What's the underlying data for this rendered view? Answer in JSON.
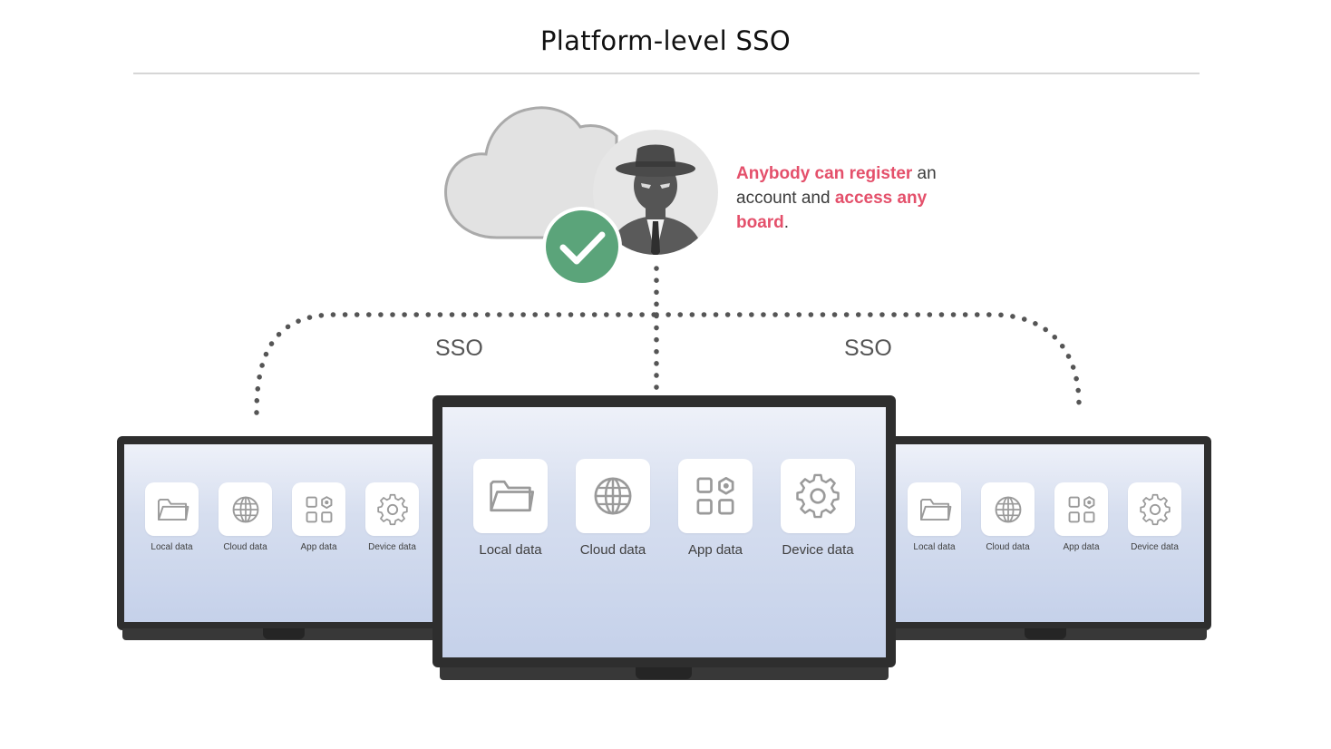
{
  "title": "Platform-level SSO",
  "caption": {
    "part1": "Anybody can register",
    "part2": " an account and ",
    "part3": "access any board",
    "part4": "."
  },
  "connector_labels": {
    "left": "SSO",
    "right": "SSO"
  },
  "tiles": [
    {
      "label": "Local data",
      "icon": "folder-icon"
    },
    {
      "label": "Cloud data",
      "icon": "globe-icon"
    },
    {
      "label": "App data",
      "icon": "apps-grid-icon"
    },
    {
      "label": "Device data",
      "icon": "gear-icon"
    }
  ],
  "colors": {
    "highlight": "#e4506b",
    "check_green": "#5ba47a",
    "cloud_fill": "#e2e2e2",
    "bezel": "#2e2e2e"
  }
}
